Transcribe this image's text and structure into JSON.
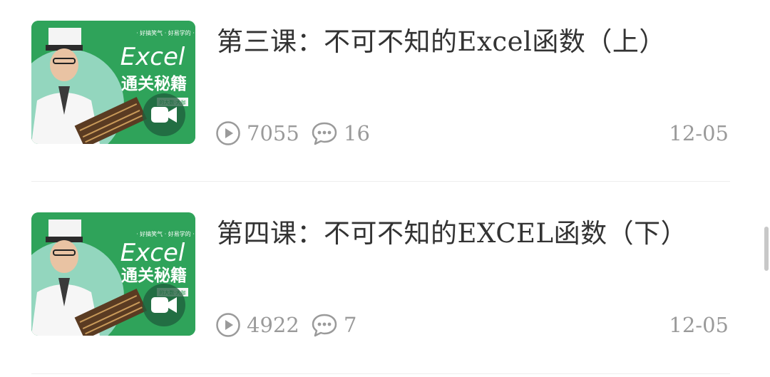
{
  "lessons": [
    {
      "title": "第三课：不可不知的Excel函数（上）",
      "views": "7055",
      "comments": "16",
      "date": "12-05",
      "thumbnail": {
        "slogan": "· 好搞笑气 · 好易学的 ·",
        "course_title": "Excel",
        "course_subtitle": "通关秘籍",
        "badge": "的大数·大咖"
      }
    },
    {
      "title": "第四课：不可不知的EXCEL函数（下）",
      "views": "4922",
      "comments": "7",
      "date": "12-05",
      "thumbnail": {
        "slogan": "· 好搞笑气 · 好易学的 ·",
        "course_title": "Excel",
        "course_subtitle": "通关秘籍",
        "badge": "的大数·大咖"
      }
    }
  ],
  "colors": {
    "thumbnail_bg": "#2fa35a",
    "text_primary": "#333333",
    "text_secondary": "#9a9a9a",
    "divider": "#eeeeee"
  },
  "icons": {
    "views": "play-circle-icon",
    "comments": "comment-bubble-icon",
    "thumbnail_overlay": "video-camera-icon"
  }
}
